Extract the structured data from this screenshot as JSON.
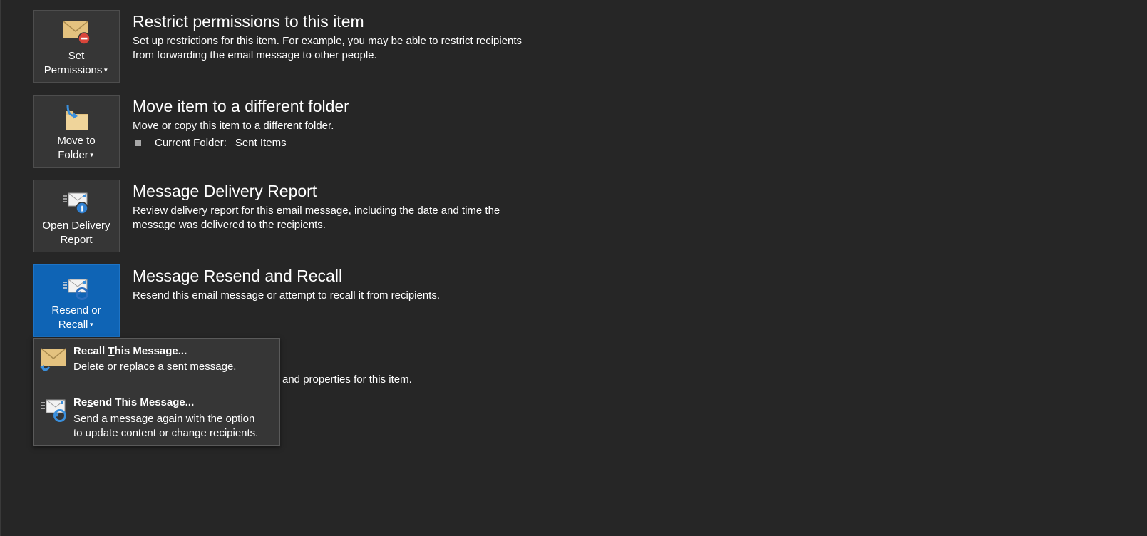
{
  "sections": [
    {
      "button": {
        "line1": "Set",
        "line2": "Permissions",
        "icon": "envelope-permissions-icon"
      },
      "title": "Restrict permissions to this item",
      "desc_line1": "Set up restrictions for this item. For example, you may be able to restrict recipients",
      "desc_line2": "from forwarding the email message to other people."
    },
    {
      "button": {
        "line1": "Move to",
        "line2": "Folder",
        "icon": "move-folder-icon"
      },
      "title": "Move item to a different folder",
      "desc_line1": "Move or copy this item to a different folder.",
      "current_folder_label": "Current Folder:",
      "current_folder_value": "Sent Items"
    },
    {
      "button": {
        "line1": "Open Delivery",
        "line2": "Report",
        "icon": "delivery-report-icon"
      },
      "title": "Message Delivery Report",
      "desc_line1": "Review delivery report for this email message, including the date and time the",
      "desc_line2": "message was delivered to the recipients."
    },
    {
      "button": {
        "line1": "Resend or",
        "line2": "Recall",
        "icon": "resend-recall-icon"
      },
      "title": "Message Resend and Recall",
      "desc_line1": "Resend this email message or attempt to recall it from recipients."
    }
  ],
  "partial_text": "and properties for this item.",
  "dropdown": {
    "items": [
      {
        "title_pre": "Recall ",
        "title_u": "T",
        "title_post": "his Message...",
        "desc_line1": "Delete or replace a sent message.",
        "icon": "recall-envelope-icon"
      },
      {
        "title_pre": "Re",
        "title_u": "s",
        "title_post": "end This Message...",
        "desc_line1": "Send a message again with the option",
        "desc_line2": "to update content or change recipients.",
        "icon": "resend-envelope-icon"
      }
    ]
  },
  "colors": {
    "background": "#262626",
    "tile": "#363636",
    "tile_active": "#0f64b5",
    "envelope": "#e4c27f",
    "accent_blue": "#3a8fdc",
    "error_red": "#d9453a"
  }
}
